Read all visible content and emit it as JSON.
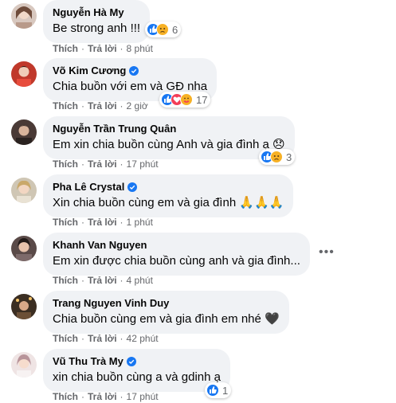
{
  "colors": {
    "bubble": "#f0f2f5",
    "meta_text": "#65676b",
    "verified": "#1877f2",
    "like": "#1877f2",
    "sad": "#f7b125",
    "love": "#f33e58"
  },
  "comments": [
    {
      "name": "Nguyễn Hà My",
      "verified": false,
      "text": "Be strong anh !!!",
      "like_label": "Thích",
      "reply_label": "Trả lời",
      "time": "8 phút",
      "reactions": {
        "icons": [
          "like-icon",
          "sad-icon"
        ],
        "count": "6"
      }
    },
    {
      "name": "Võ Kim Cương",
      "verified": true,
      "text": "Chia buồn với em và GĐ nha",
      "like_label": "Thích",
      "reply_label": "Trả lời",
      "time": "2 giờ",
      "reactions": {
        "icons": [
          "like-icon",
          "love-icon",
          "care-icon"
        ],
        "count": "17"
      }
    },
    {
      "name": "Nguyễn Trần Trung Quân",
      "verified": false,
      "text": "Em xin chia buồn cùng Anh và gia đình ạ 😞",
      "like_label": "Thích",
      "reply_label": "Trả lời",
      "time": "17 phút",
      "reactions": {
        "icons": [
          "like-icon",
          "sad-icon"
        ],
        "count": "3"
      }
    },
    {
      "name": "Pha Lê Crystal",
      "verified": true,
      "text": "Xin chia buồn cùng em và gia đình 🙏🙏🙏",
      "like_label": "Thích",
      "reply_label": "Trả lời",
      "time": "1 phút"
    },
    {
      "name": "Khanh Van Nguyen",
      "verified": false,
      "text": "Em xin được chia buồn cùng anh và gia đình...",
      "like_label": "Thích",
      "reply_label": "Trả lời",
      "time": "4 phút",
      "more_label": "•••"
    },
    {
      "name": "Trang Nguyen Vinh Duy",
      "verified": false,
      "text": "Chia buồn cùng em và gia đình em nhé 🖤",
      "like_label": "Thích",
      "reply_label": "Trả lời",
      "time": "42 phút"
    },
    {
      "name": "Vũ Thu Trà My",
      "verified": true,
      "text": "xin chia buồn cùng a và gdinh ạ",
      "like_label": "Thích",
      "reply_label": "Trả lời",
      "time": "17 phút",
      "reactions": {
        "icons": [
          "like-icon"
        ],
        "count": "1"
      }
    }
  ]
}
